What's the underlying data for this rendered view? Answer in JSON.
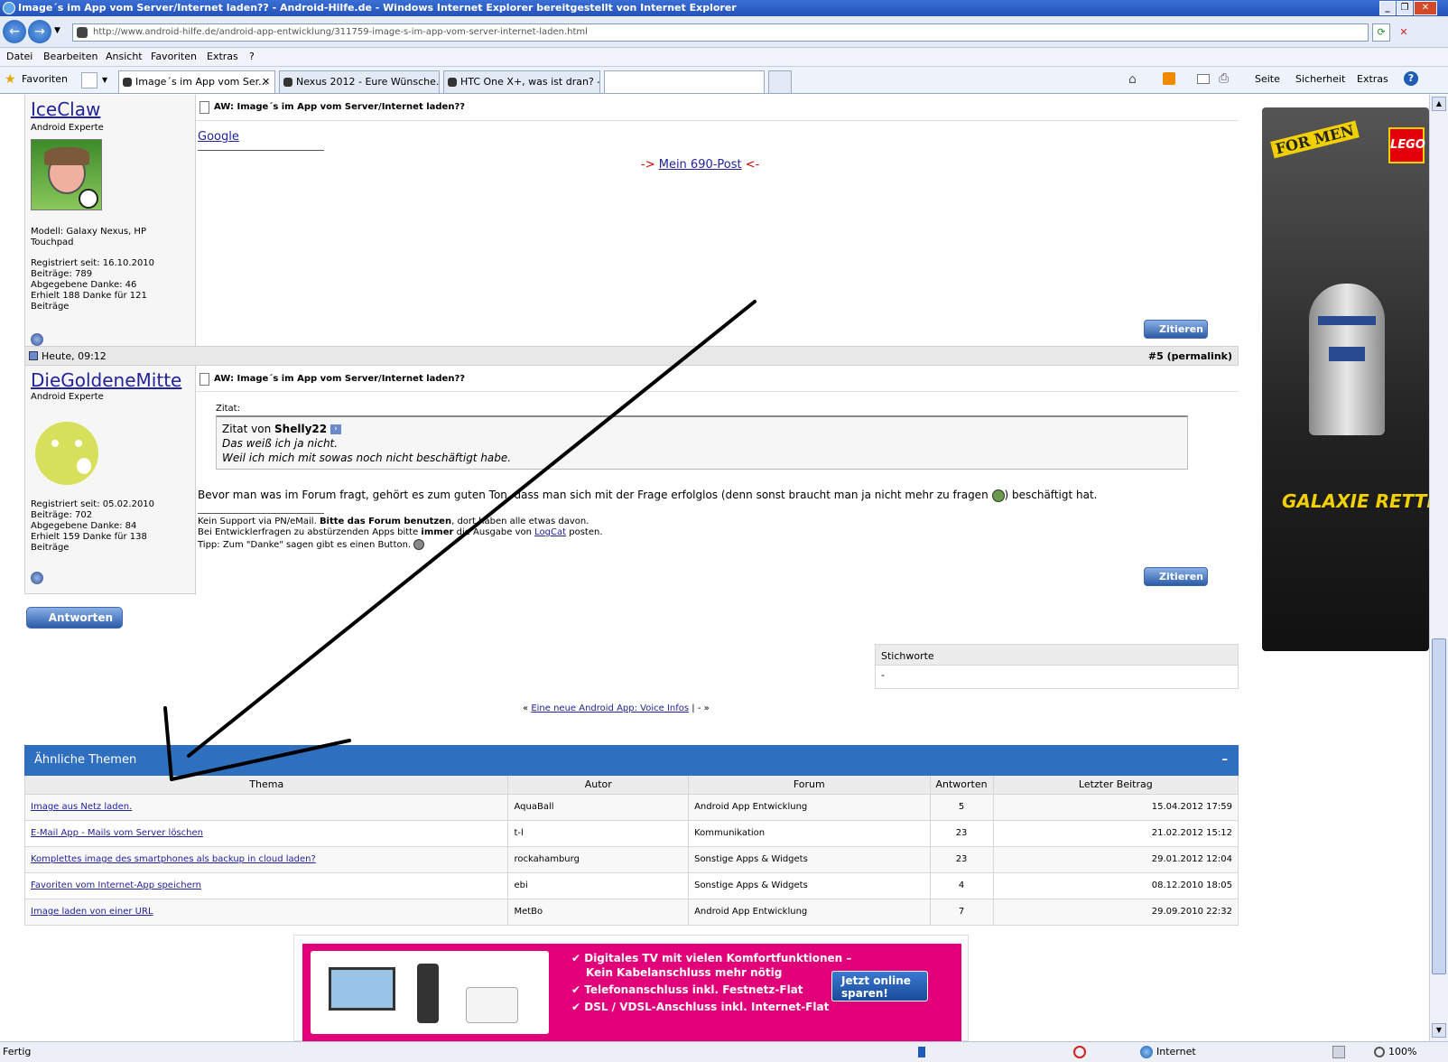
{
  "window": {
    "title": "Image´s im App vom Server/Internet laden?? - Android-Hilfe.de - Windows Internet Explorer bereitgestellt von Internet Explorer",
    "minimize": "_",
    "restore": "❐",
    "close": "✕"
  },
  "address": {
    "url": "http://www.android-hilfe.de/android-app-entwicklung/311759-image-s-im-app-vom-server-internet-laden.html"
  },
  "menu": [
    "Datei",
    "Bearbeiten",
    "Ansicht",
    "Favoriten",
    "Extras",
    "?"
  ],
  "tabs": {
    "favorites": "Favoriten",
    "items": [
      "Image´s im App vom Ser...",
      "Nexus 2012 - Eure Wünsche...",
      "HTC One X+, was ist dran? -..."
    ]
  },
  "toolbar": {
    "page": "Seite",
    "security": "Sicherheit",
    "extras": "Extras"
  },
  "post1": {
    "username": "IceClaw",
    "rank": "Android Experte",
    "model": "Modell: Galaxy Nexus, HP Touchpad",
    "registered": "Registriert seit: 16.10.2010",
    "posts": "Beiträge: 789",
    "thanks_given": "Abgegebene Danke: 46",
    "thanks_received": "Erhielt 188 Danke für 121 Beiträge",
    "title": "AW: Image´s im App vom Server/Internet laden??",
    "link": "Google",
    "sig_pre": "->",
    "sig_link": "Mein 690-Post",
    "sig_post": "<-",
    "quote_btn": "Zitieren"
  },
  "post2": {
    "date": "Heute, 09:12",
    "number": "#5 (permalink)",
    "username": "DieGoldeneMitte",
    "rank": "Android Experte",
    "registered": "Registriert seit: 05.02.2010",
    "posts": "Beiträge: 702",
    "thanks_given": "Abgegebene Danke: 84",
    "thanks_received": "Erhielt 159 Danke für 138 Beiträge",
    "title": "AW: Image´s im App vom Server/Internet laden??",
    "quote_label": "Zitat:",
    "quote_from_pre": "Zitat von",
    "quote_author": "Shelly22",
    "quote_line1": "Das weiß ich ja nicht.",
    "quote_line2": "Weil ich mich mit sowas noch nicht beschäftigt habe.",
    "body": "Bevor man was im Forum fragt, gehört es zum guten Ton, dass man sich mit der Frage erfolglos (denn sonst braucht man ja nicht mehr zu fragen",
    "body_end": ") beschäftigt hat.",
    "sig1_a": "Kein Support via PN/eMail.",
    "sig1_b": "Bitte das Forum benutzen",
    "sig1_c": ", dort haben alle etwas davon.",
    "sig2_a": "Bei Entwicklerfragen zu abstürzenden Apps bitte",
    "sig2_b": "immer",
    "sig2_c": "die Ausgabe von",
    "sig2_link": "LogCat",
    "sig2_d": "posten.",
    "sig3": "Tipp: Zum \"Danke\" sagen gibt es einen Button.",
    "quote_btn": "Zitieren"
  },
  "reply_btn": "Antworten",
  "tags": {
    "header": "Stichworte",
    "value": "-"
  },
  "nav": {
    "prev": "«",
    "link": "Eine neue Android App: Voice Infos",
    "sep": "| - »"
  },
  "similar": {
    "title": "Ähnliche Themen",
    "collapse": "–",
    "headers": [
      "Thema",
      "Autor",
      "Forum",
      "Antworten",
      "Letzter Beitrag"
    ],
    "rows": [
      {
        "topic": "Image aus Netz laden.",
        "author": "AquaBall",
        "forum": "Android App Entwicklung",
        "replies": "5",
        "last": "15.04.2012 17:59"
      },
      {
        "topic": "E-Mail App - Mails vom Server löschen",
        "author": "t-l",
        "forum": "Kommunikation",
        "replies": "23",
        "last": "21.02.2012 15:12"
      },
      {
        "topic": "Komplettes image des smartphones als backup in cloud laden?",
        "author": "rockahamburg",
        "forum": "Sonstige Apps & Widgets",
        "replies": "23",
        "last": "29.01.2012 12:04"
      },
      {
        "topic": "Favoriten vom Internet-App speichern",
        "author": "ebi",
        "forum": "Sonstige Apps & Widgets",
        "replies": "4",
        "last": "08.12.2010 18:05"
      },
      {
        "topic": "Image laden von einer URL",
        "author": "MetBo",
        "forum": "Android App Entwicklung",
        "replies": "7",
        "last": "29.09.2010 22:32"
      }
    ]
  },
  "ad_side": {
    "brand": "LEGO",
    "for_men": "FOR MEN",
    "slogan": "GALAXIE RETTEN."
  },
  "ad_bottom": {
    "line1": "Digitales TV mit vielen Komfortfunktionen –",
    "line1b": "Kein Kabelanschluss mehr nötig",
    "line2": "Telefonanschluss inkl. Festnetz-Flat",
    "line3": "DSL / VDSL-Anschluss inkl. Internet-Flat",
    "cta": "Jetzt online sparen!"
  },
  "status": {
    "left": "Fertig",
    "zone": "Internet",
    "zoom": "100%"
  },
  "colors": {
    "header_blue": "#2f6fc0",
    "link": "#22229c",
    "ad_pink": "#e2007a"
  }
}
